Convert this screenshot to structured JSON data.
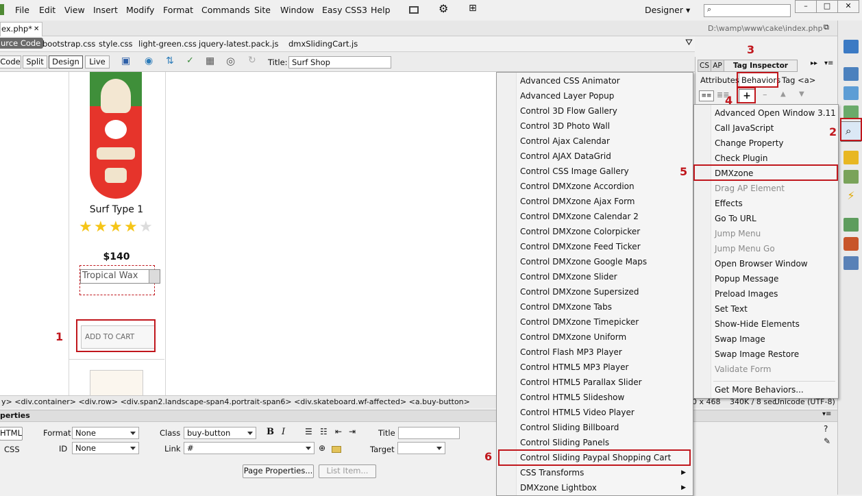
{
  "menubar": {
    "items": [
      "File",
      "Edit",
      "View",
      "Insert",
      "Modify",
      "Format",
      "Commands",
      "Site",
      "Window",
      "Easy CSS3",
      "Help"
    ],
    "workspace": "Designer",
    "search_placeholder": ""
  },
  "document": {
    "tab_label": "ex.php*",
    "path": "D:\\wamp\\www\\cake\\index.php",
    "related_files": [
      "urce Code",
      "bootstrap.css",
      "style.css",
      "light-green.css",
      "jquery-latest.pack.js",
      "dmxSlidingCart.js"
    ],
    "view_buttons": [
      "Code",
      "Split",
      "Design",
      "Live"
    ],
    "title_label": "Title:",
    "title_value": "Surf Shop"
  },
  "product": {
    "name": "Surf Type 1",
    "price": "$140",
    "select_value": "Tropical Wax",
    "cart_button": "ADD TO CART",
    "rating": 4,
    "rating_max": 5
  },
  "statusbar": {
    "breadcrumb": "y> <div.container> <div.row> <div.span2.landscape-span4.portrait-span6> <div.skateboard.wf-affected> <a.buy-button>",
    "size": "0 x 468",
    "download": "340K / 8 sec",
    "encoding": "Unicode (UTF-8)"
  },
  "properties": {
    "panel_title": "perties",
    "html_btn": "HTML",
    "css_btn": "CSS",
    "format_label": "Format",
    "format_value": "None",
    "id_label": "ID",
    "id_value": "None",
    "class_label": "Class",
    "class_value": "buy-button",
    "link_label": "Link",
    "link_value": "#",
    "title_label": "Title",
    "target_label": "Target",
    "page_props_btn": "Page Properties...",
    "list_item_btn": "List Item..."
  },
  "right_panel": {
    "tabs": [
      "CS",
      "AP",
      "Tag Inspector"
    ],
    "subtabs": [
      "Attributes",
      "Behaviors",
      "Tag <a>"
    ],
    "add_button": "+"
  },
  "menu_components": {
    "items": [
      {
        "label": "Advanced CSS Animator"
      },
      {
        "label": "Advanced Layer Popup"
      },
      {
        "label": "Control 3D Flow Gallery"
      },
      {
        "label": "Control 3D Photo Wall"
      },
      {
        "label": "Control Ajax Calendar"
      },
      {
        "label": "Control AJAX DataGrid"
      },
      {
        "label": "Control CSS Image Gallery"
      },
      {
        "label": "Control DMXzone Accordion"
      },
      {
        "label": "Control DMXzone Ajax Form"
      },
      {
        "label": "Control DMXzone Calendar 2"
      },
      {
        "label": "Control DMXzone Colorpicker"
      },
      {
        "label": "Control DMXzone Feed Ticker"
      },
      {
        "label": "Control DMXzone Google Maps"
      },
      {
        "label": "Control DMXzone Slider"
      },
      {
        "label": "Control DMXzone Supersized"
      },
      {
        "label": "Control DMXzone Tabs"
      },
      {
        "label": "Control DMXzone Timepicker"
      },
      {
        "label": "Control DMXzone Uniform"
      },
      {
        "label": "Control Flash MP3 Player"
      },
      {
        "label": "Control HTML5 MP3 Player"
      },
      {
        "label": "Control HTML5 Parallax Slider"
      },
      {
        "label": "Control HTML5 Slideshow"
      },
      {
        "label": "Control HTML5 Video Player"
      },
      {
        "label": "Control Sliding Billboard"
      },
      {
        "label": "Control Sliding Panels"
      },
      {
        "label": "Control Sliding Paypal Shopping Cart"
      },
      {
        "label": "CSS Transforms",
        "submenu": true
      },
      {
        "label": "DMXzone Lightbox",
        "submenu": true
      }
    ]
  },
  "menu_behaviors": {
    "items": [
      {
        "label": "Advanced Open Window 3.11",
        "enabled": true
      },
      {
        "label": "Call JavaScript",
        "enabled": true
      },
      {
        "label": "Change Property",
        "enabled": true
      },
      {
        "label": "Check Plugin",
        "enabled": true
      },
      {
        "label": "DMXzone",
        "enabled": true
      },
      {
        "label": "Drag AP Element",
        "enabled": false
      },
      {
        "label": "Effects",
        "enabled": true
      },
      {
        "label": "Go To URL",
        "enabled": true
      },
      {
        "label": "Jump Menu",
        "enabled": false
      },
      {
        "label": "Jump Menu Go",
        "enabled": false
      },
      {
        "label": "Open Browser Window",
        "enabled": true
      },
      {
        "label": "Popup Message",
        "enabled": true
      },
      {
        "label": "Preload Images",
        "enabled": true
      },
      {
        "label": "Set Text",
        "enabled": true
      },
      {
        "label": "Show-Hide Elements",
        "enabled": true
      },
      {
        "label": "Swap Image",
        "enabled": true
      },
      {
        "label": "Swap Image Restore",
        "enabled": true
      },
      {
        "label": "Validate Form",
        "enabled": false
      },
      {
        "label": "Get More Behaviors...",
        "enabled": true
      }
    ]
  },
  "callouts": [
    "1",
    "2",
    "3",
    "4",
    "5",
    "6"
  ],
  "colors": {
    "callout_red": "#c0161c",
    "board_green": "#3f8f3a",
    "board_red": "#e6342b"
  }
}
